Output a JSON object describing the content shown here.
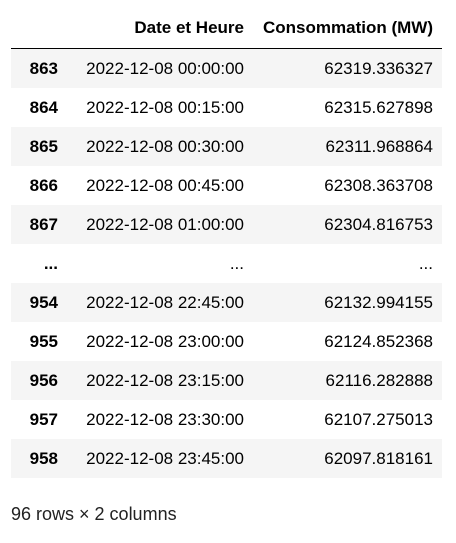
{
  "table": {
    "columns": [
      "",
      "Date et Heure",
      "Consommation (MW)"
    ],
    "rows": [
      [
        "863",
        "2022-12-08 00:00:00",
        "62319.336327"
      ],
      [
        "864",
        "2022-12-08 00:15:00",
        "62315.627898"
      ],
      [
        "865",
        "2022-12-08 00:30:00",
        "62311.968864"
      ],
      [
        "866",
        "2022-12-08 00:45:00",
        "62308.363708"
      ],
      [
        "867",
        "2022-12-08 01:00:00",
        "62304.816753"
      ],
      [
        "...",
        "...",
        "..."
      ],
      [
        "954",
        "2022-12-08 22:45:00",
        "62132.994155"
      ],
      [
        "955",
        "2022-12-08 23:00:00",
        "62124.852368"
      ],
      [
        "956",
        "2022-12-08 23:15:00",
        "62116.282888"
      ],
      [
        "957",
        "2022-12-08 23:30:00",
        "62107.275013"
      ],
      [
        "958",
        "2022-12-08 23:45:00",
        "62097.818161"
      ]
    ]
  },
  "shape_text": "96 rows × 2 columns",
  "colors": {
    "row_stripe": "#f5f5f5",
    "header_border": "#000000"
  }
}
